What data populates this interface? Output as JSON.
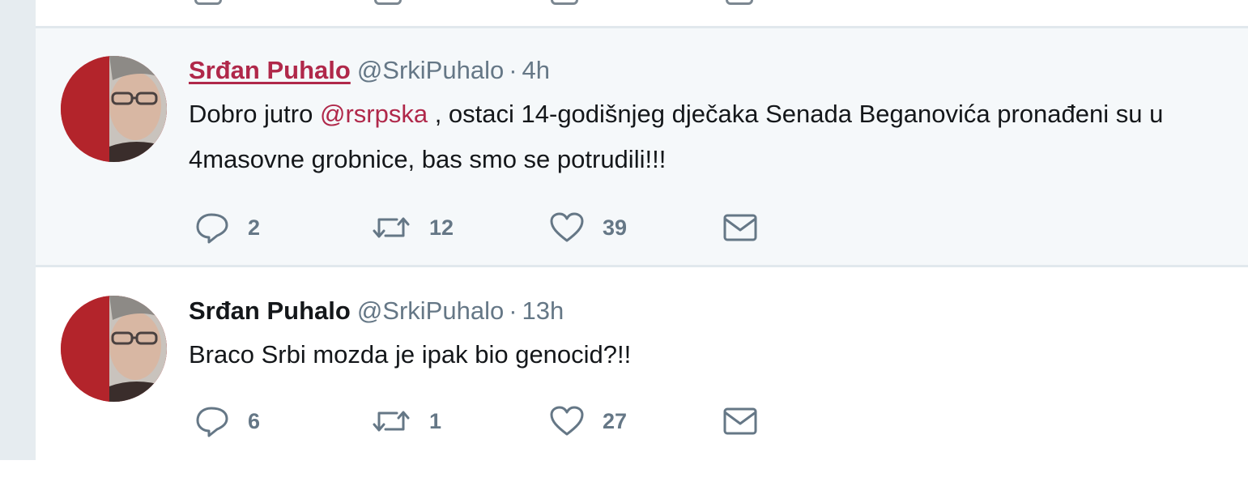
{
  "tweets": [
    {
      "name": "Srđan Puhalo",
      "handle": "@SrkiPuhalo",
      "separator": "·",
      "time": "4h",
      "text_before": "Dobro jutro ",
      "mention": "@rsrpska",
      "text_after": " , ostaci 14-godišnjeg dječaka Senada Beganovića pronađeni su u 4masovne grobnice, bas smo se potrudili!!!",
      "replies": "2",
      "retweets": "12",
      "likes": "39",
      "highlighted": true
    },
    {
      "name": "Srđan Puhalo",
      "handle": "@SrkiPuhalo",
      "separator": "·",
      "time": "13h",
      "text": "Braco Srbi mozda je ipak bio genocid?!!",
      "replies": "6",
      "retweets": "1",
      "likes": "27",
      "highlighted": false
    }
  ],
  "colors": {
    "name_highlight": "#b0284a",
    "mention": "#b0284a",
    "muted": "#657786",
    "highlight_bg": "#f5f8fa",
    "left_bar": "#e6ecf0"
  },
  "icons": [
    "reply-icon",
    "retweet-icon",
    "like-icon",
    "direct-message-icon"
  ]
}
